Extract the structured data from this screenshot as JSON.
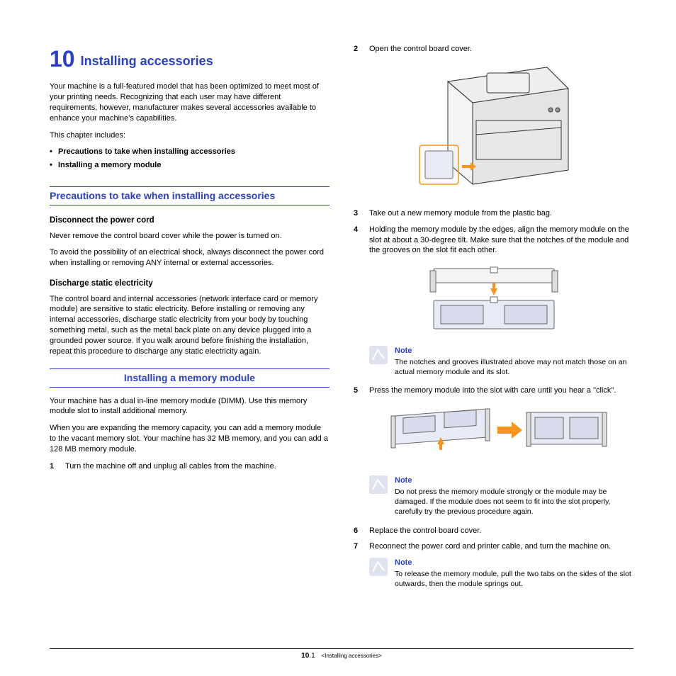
{
  "chapter": {
    "number": "10",
    "title": "Installing accessories"
  },
  "intro": "Your machine is a full-featured model that has been optimized to meet most of your printing needs. Recognizing that each user may have different requirements, however, manufacturer makes several accessories available to enhance your machine's capabilities.",
  "includes_label": "This chapter includes:",
  "includes": [
    "Precautions to take when installing accessories",
    "Installing a memory module"
  ],
  "precautions": {
    "heading": "Precautions to take when installing accessories",
    "sub1": {
      "title": "Disconnect the power cord",
      "p1": "Never remove the control board cover while the power is turned on.",
      "p2": "To avoid the possibility of an electrical shock, always disconnect the power cord when installing or removing ANY internal or external accessories."
    },
    "sub2": {
      "title": "Discharge static electricity",
      "p1": "The control board and internal accessories (network interface card or memory module) are sensitive to static electricity. Before installing or removing any internal accessories, discharge static electricity from your body by touching something metal, such as the metal back plate on any device plugged into a grounded power source. If you walk around before finishing the installation, repeat this procedure to discharge any static electricity again."
    }
  },
  "install": {
    "heading": "Installing a memory module",
    "p1": "Your machine has a dual in-line memory module (DIMM). Use this memory module slot to install additional memory.",
    "p2": "When you are expanding the memory capacity, you can add a memory module to the vacant memory slot. Your machine has 32 MB memory, and you can add a 128 MB memory module."
  },
  "steps": {
    "s1": "Turn the machine off and unplug all cables from the machine.",
    "s2": "Open the control board cover.",
    "s3": "Take out a new memory module from the plastic bag.",
    "s4": "Holding the memory module by the edges, align the memory module on the slot at about a 30-degree tilt. Make sure that the notches of the module and the grooves on the slot fit each other.",
    "s5": "Press the memory module into the slot with care until you hear a \"click\".",
    "s6": "Replace the control board cover.",
    "s7": "Reconnect the power cord and printer cable, and turn the machine on."
  },
  "notes": {
    "label": "Note",
    "n1": "The notches and grooves illustrated above may not match those on an actual memory module and its slot.",
    "n2": "Do not press the memory module strongly or the module may be damaged. If the module does not seem to fit into the slot properly, carefully try the previous procedure again.",
    "n3": "To release the memory module, pull the two tabs on the sides of the slot outwards, then the module springs out."
  },
  "footer": {
    "chapter_num": "10",
    "page_sub": ".1",
    "chapter_name": "<Installing accessories>"
  }
}
